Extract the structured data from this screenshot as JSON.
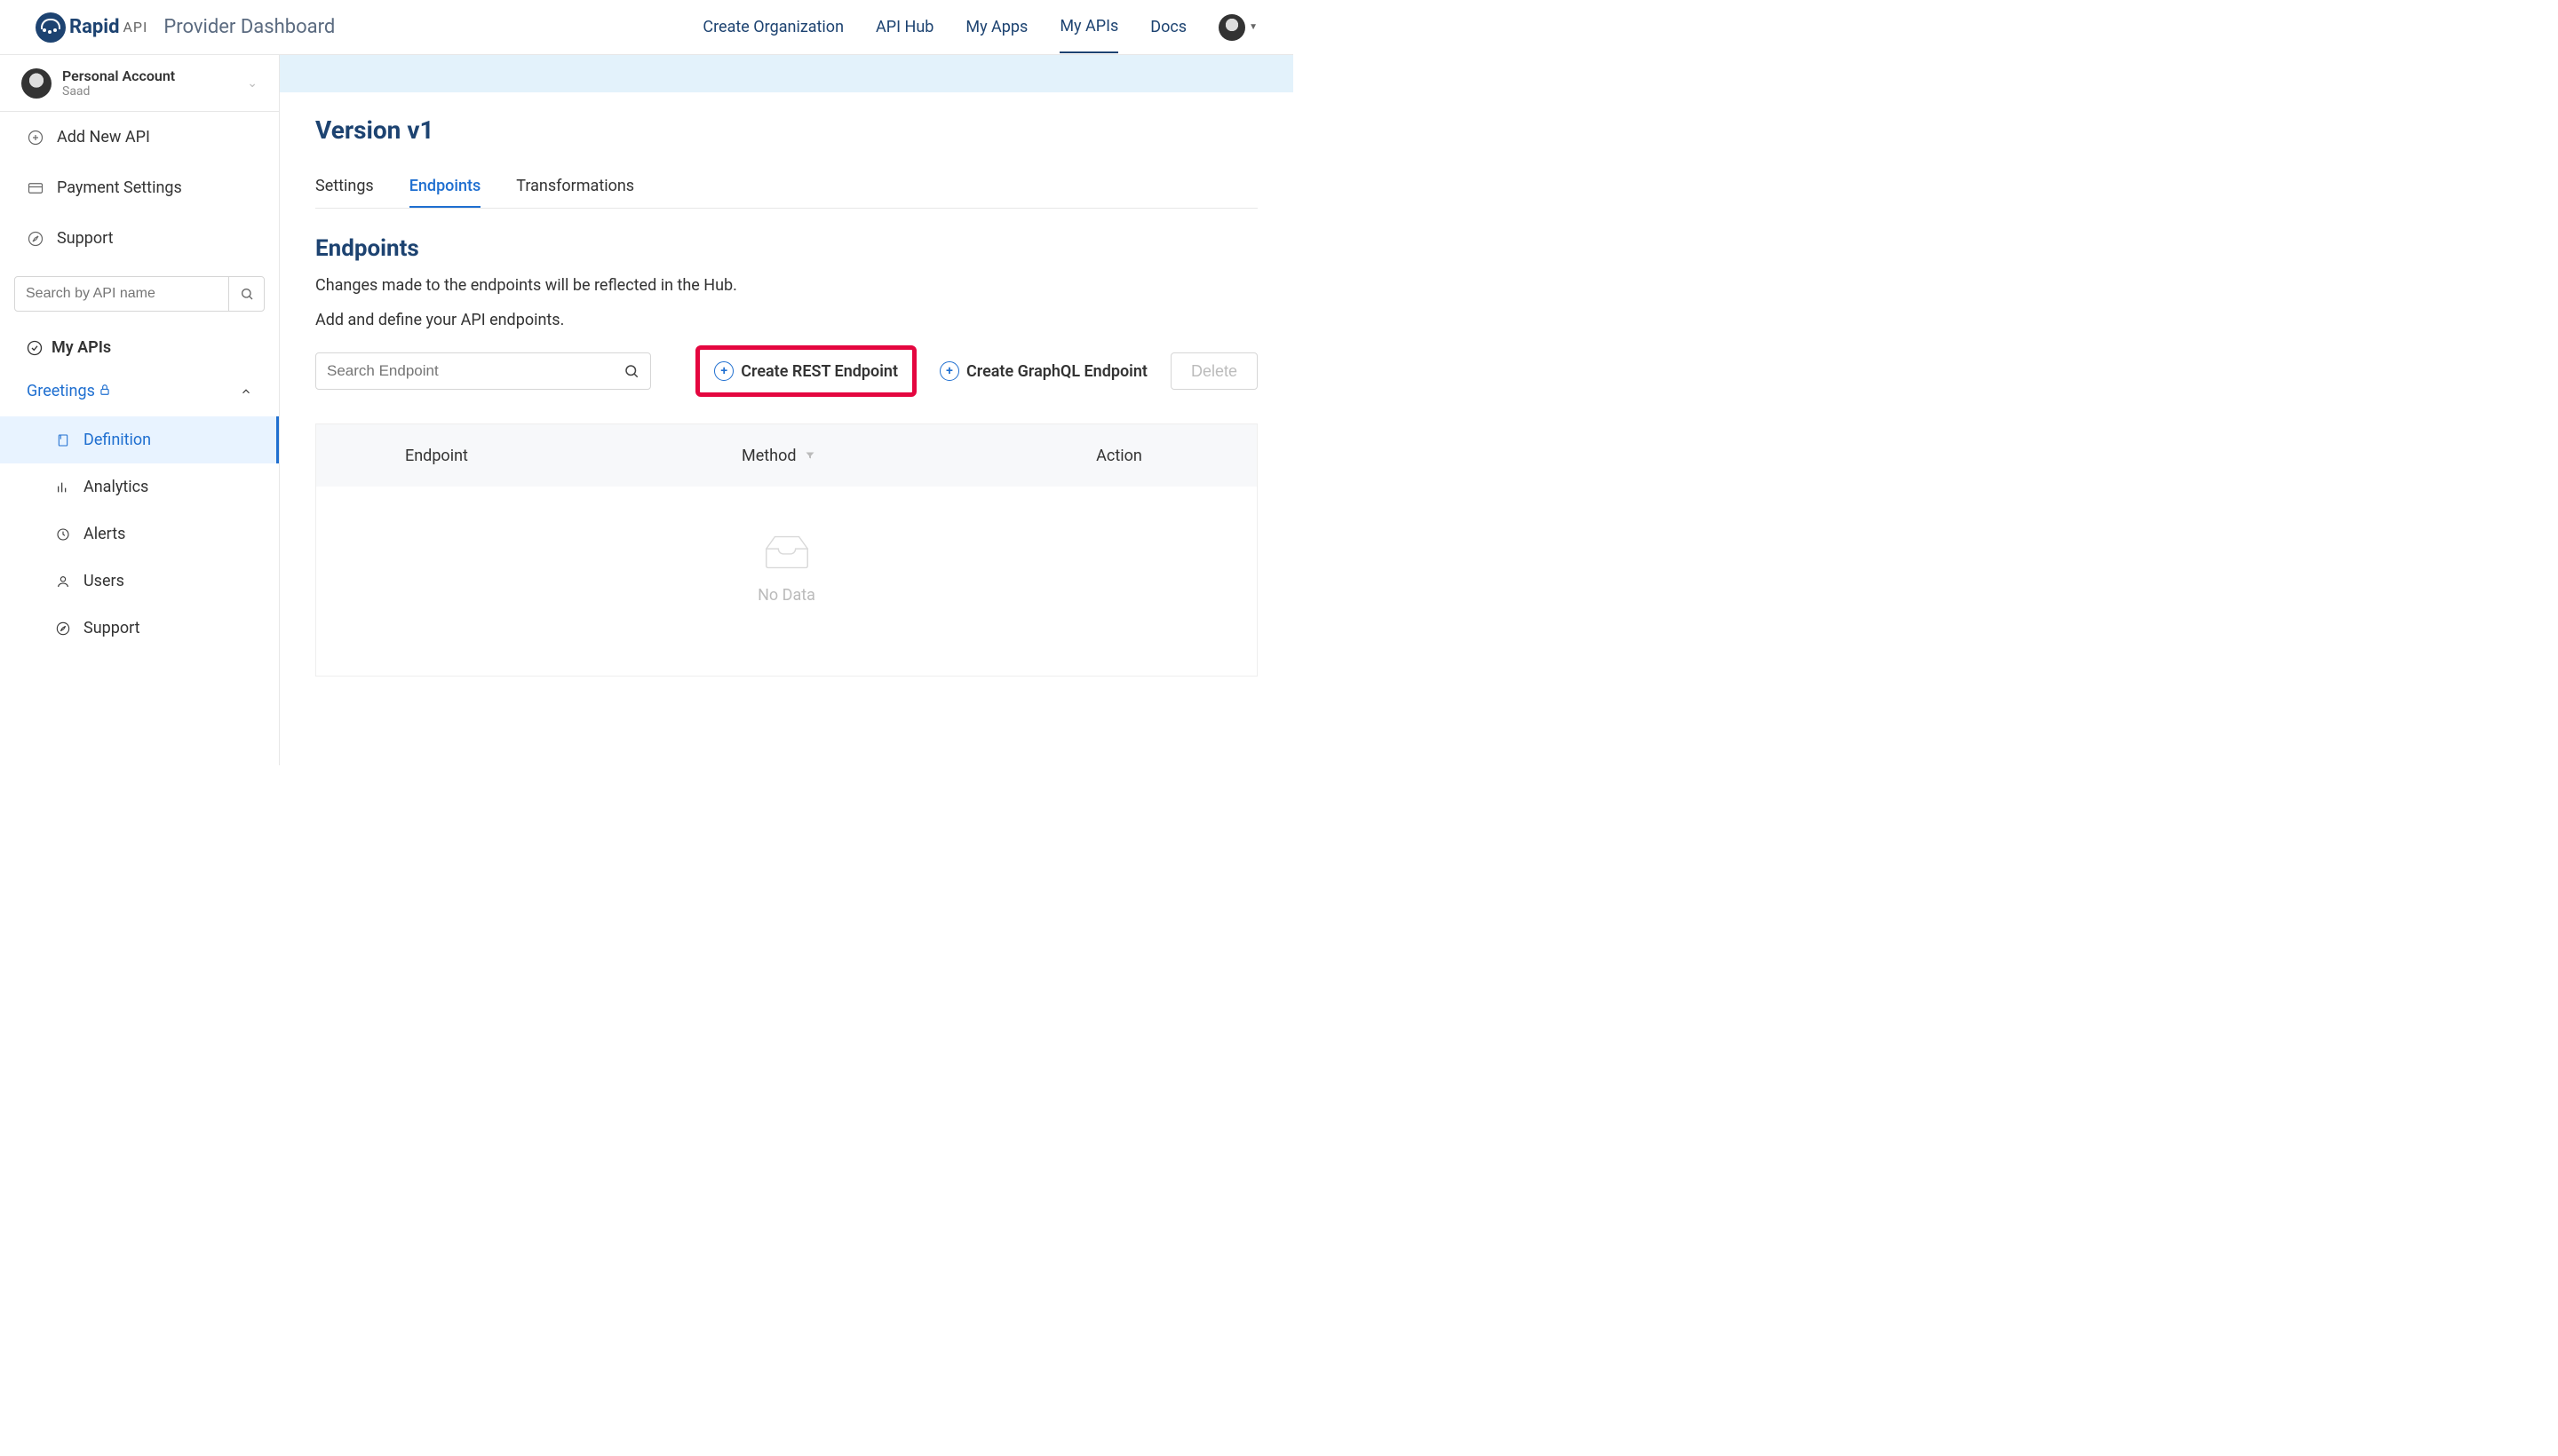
{
  "brand": {
    "name": "Rapid",
    "suffix": "API",
    "subtitle": "Provider Dashboard"
  },
  "nav": {
    "create_org": "Create Organization",
    "api_hub": "API Hub",
    "my_apps": "My Apps",
    "my_apis": "My APIs",
    "docs": "Docs"
  },
  "account": {
    "label": "Personal Account",
    "user": "Saad"
  },
  "sidebar": {
    "add_api": "Add New API",
    "payment": "Payment Settings",
    "support": "Support",
    "search_placeholder": "Search by API name",
    "my_apis": "My APIs",
    "api_name": "Greetings",
    "subitems": {
      "definition": "Definition",
      "analytics": "Analytics",
      "alerts": "Alerts",
      "users": "Users",
      "support": "Support"
    }
  },
  "main": {
    "title": "Version v1",
    "tabs": {
      "settings": "Settings",
      "endpoints": "Endpoints",
      "transformations": "Transformations"
    },
    "section_title": "Endpoints",
    "desc1": "Changes made to the endpoints will be reflected in the Hub.",
    "desc2": "Add and define your API endpoints.",
    "search_placeholder": "Search Endpoint",
    "create_rest": "Create REST Endpoint",
    "create_graphql": "Create GraphQL Endpoint",
    "delete": "Delete",
    "columns": {
      "endpoint": "Endpoint",
      "method": "Method",
      "action": "Action"
    },
    "empty": "No Data"
  }
}
